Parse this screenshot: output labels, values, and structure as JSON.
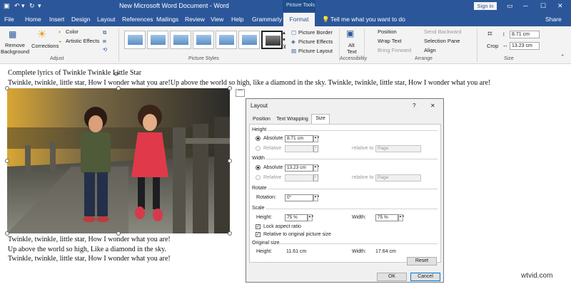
{
  "window": {
    "title": "New Microsoft Word Document  -  Word",
    "context": "Picture Tools",
    "signin": "Sign in"
  },
  "tabs": [
    "File",
    "Home",
    "Insert",
    "Design",
    "Layout",
    "References",
    "Mailings",
    "Review",
    "View",
    "Help",
    "Grammarly",
    "Format"
  ],
  "tell_me": "Tell me what you want to do",
  "share": "Share",
  "ribbon": {
    "remove_bg": [
      "Remove",
      "Background"
    ],
    "corrections": "Corrections",
    "color": "Color",
    "artistic": "Artistic Effects",
    "adjust": "Adjust",
    "picture_styles": "Picture Styles",
    "picture_border": "Picture Border",
    "picture_effects": "Picture Effects",
    "picture_layout": "Picture Layout",
    "alt_text": [
      "Alt",
      "Text"
    ],
    "accessibility": "Accessibility",
    "position": "Position",
    "wrap_text": "Wrap Text",
    "bring_forward": "Bring Forward",
    "send_backward": "Send Backward",
    "selection_pane": "Selection Pane",
    "align": "Align",
    "arrange": "Arrange",
    "crop": "Crop",
    "height_val": "8.71 cm",
    "width_val": "13.23 cm",
    "size": "Size"
  },
  "doc": {
    "heading": "Complete lyrics of Twinkle Twinkle Little Star",
    "line1": "Twinkle, twinkle, little star, How I wonder what you are!Up above the world so high, like a diamond in the sky. Twinkle, twinkle, little star, How I wonder what you are!",
    "line2": "Twinkle, twinkle, little star, How I wonder what you are!",
    "line3": "Up above the world so high, Like a diamond in the sky.",
    "line4": "Twinkle, twinkle, little star, How I wonder what you are!"
  },
  "dialog": {
    "title": "Layout",
    "help": "?",
    "close": "✕",
    "tabs": [
      "Position",
      "Text Wrapping",
      "Size"
    ],
    "height_section": "Height",
    "absolute": "Absolute",
    "relative": "Relative",
    "relative_to": "relative to",
    "height_abs": "8.71 cm",
    "page": "Page",
    "width_section": "Width",
    "width_abs": "13.23 cm",
    "rotate_section": "Rotate",
    "rotation": "Rotation:",
    "rotation_val": "0°",
    "scale_section": "Scale",
    "scale_height": "Height:",
    "scale_height_val": "75 %",
    "scale_width": "Width:",
    "scale_width_val": "75 %",
    "lock_aspect": "Lock aspect ratio",
    "relative_orig": "Relative to original picture size",
    "orig_section": "Original size",
    "orig_height_label": "Height:",
    "orig_height": "11.61 cm",
    "orig_width_label": "Width:",
    "orig_width": "17.64 cm",
    "reset": "Reset",
    "ok": "OK",
    "cancel": "Cancel"
  },
  "watermark": "wtvid.com"
}
